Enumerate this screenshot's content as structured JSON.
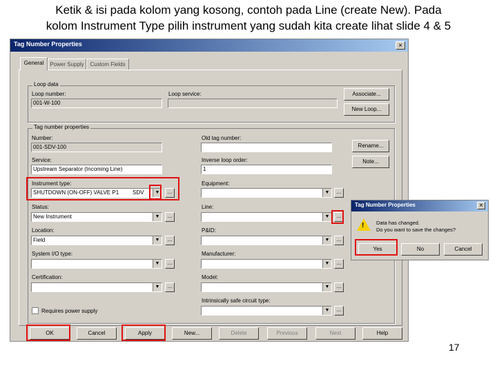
{
  "caption": {
    "line1": "Ketik & isi pada kolom yang kosong, contoh pada Line (create New). Pada",
    "line2": "kolom Instrument Type pilih instrument yang sudah kita create lihat slide 4 & 5"
  },
  "dialog": {
    "title": "Tag Number Properties",
    "close_glyph": "×",
    "tabs": [
      "General",
      "Power Supply",
      "Custom Fields"
    ],
    "loop_data": {
      "group_label": "Loop data",
      "loop_number_label": "Loop number:",
      "loop_number_value": "001-W-100",
      "loop_service_label": "Loop service:",
      "loop_service_value": "",
      "associate_button": "Associate...",
      "new_loop_button": "New Loop..."
    },
    "tag_props": {
      "group_label": "Tag number properties",
      "number_label": "Number:",
      "number_value": "001-SDV-100",
      "old_tag_label": "Old tag number:",
      "rename_button": "Rename...",
      "service_label": "Service:",
      "service_value": "Upstream Separator (Incoming Line)",
      "inverse_loop_label": "Inverse loop order:",
      "inverse_loop_value": "1",
      "note_button": "Note...",
      "instrument_type_label": "Instrument type:",
      "instrument_type_value": "SHUTDOWN (ON-OFF) VALVE P1",
      "instrument_type_code": "SDV",
      "equipment_label": "Equipment:",
      "status_label": "Status:",
      "status_value": "New Instrument",
      "line_label": "Line:",
      "location_label": "Location:",
      "location_value": "Field",
      "pid_label": "P&ID:",
      "system_io_label": "System I/O type:",
      "manufacturer_label": "Manufacturer:",
      "certification_label": "Certification:",
      "model_label": "Model:",
      "intrinsic_label": "Intrinsically safe circuit type:",
      "requires_power_label": "Requires power supply"
    },
    "buttons": {
      "ok": "OK",
      "cancel": "Cancel",
      "apply": "Apply",
      "new": "New...",
      "delete": "Delete",
      "previous": "Previous",
      "next": "Next",
      "help": "Help"
    },
    "dots_label": "...",
    "dropdown_glyph": "▼"
  },
  "popup": {
    "title": "Tag Number Properties",
    "close_glyph": "×",
    "message_line1": "Data has changed.",
    "message_line2": "Do you want to save the changes?",
    "yes": "Yes",
    "no": "No",
    "cancel": "Cancel",
    "warn_glyph": "!"
  },
  "page_number": "17",
  "colors": {
    "highlight": "#e01010",
    "titlebar": "#0a246a",
    "dialog_bg": "#d4d0c8"
  }
}
